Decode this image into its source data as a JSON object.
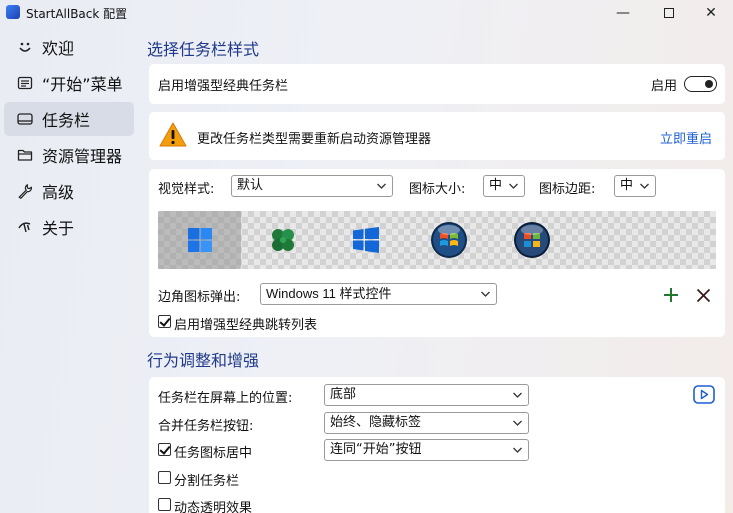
{
  "window": {
    "title": "StartAllBack 配置",
    "minimize_glyph": "—",
    "close_glyph": "✕"
  },
  "sidebar": {
    "items": [
      {
        "label": "欢迎",
        "icon": "smile-icon"
      },
      {
        "label": "“开始”菜单",
        "icon": "menu-icon"
      },
      {
        "label": "任务栏",
        "icon": "taskbar-icon",
        "active": true
      },
      {
        "label": "资源管理器",
        "icon": "folder-icon"
      },
      {
        "label": "高级",
        "icon": "wrench-icon"
      },
      {
        "label": "关于",
        "icon": "about-icon"
      }
    ]
  },
  "taskbar_style": {
    "section_title": "选择任务栏样式",
    "enhanced_classic_label": "启用增强型经典任务栏",
    "toggle_state_label": "启用",
    "warning_text": "更改任务栏类型需要重新启动资源管理器",
    "restart_link": "立即重启",
    "visual_style_label": "视觉样式:",
    "visual_style_value": "默认",
    "icon_size_label": "图标大小:",
    "icon_size_value": "中",
    "icon_margin_label": "图标边距:",
    "icon_margin_value": "中",
    "style_options": [
      "windows-11-logo-icon",
      "clover-icon",
      "windows-10-logo-icon",
      "windows-7-orb-icon",
      "windows-vista-orb-icon"
    ],
    "corner_popup_label": "边角图标弹出:",
    "corner_popup_value": "Windows 11 样式控件",
    "jumplist_label": "启用增强型经典跳转列表",
    "jumplist_checked": true
  },
  "behavior": {
    "section_title": "行为调整和增强",
    "position_label": "任务栏在屏幕上的位置:",
    "position_value": "底部",
    "combine_label": "合并任务栏按钮:",
    "combine_value": "始终、隐藏标签",
    "center_label": "任务图标居中",
    "center_checked": true,
    "center_value": "连同“开始”按钮",
    "split_label": "分割任务栏",
    "split_checked": false,
    "dynamic_label": "动态透明效果",
    "dynamic_checked": false
  },
  "colors": {
    "accent_blue": "#1f3a8a",
    "link_blue": "#1d5fd1",
    "warning_orange": "#f59e0b",
    "add_green": "#1f7a2e"
  }
}
